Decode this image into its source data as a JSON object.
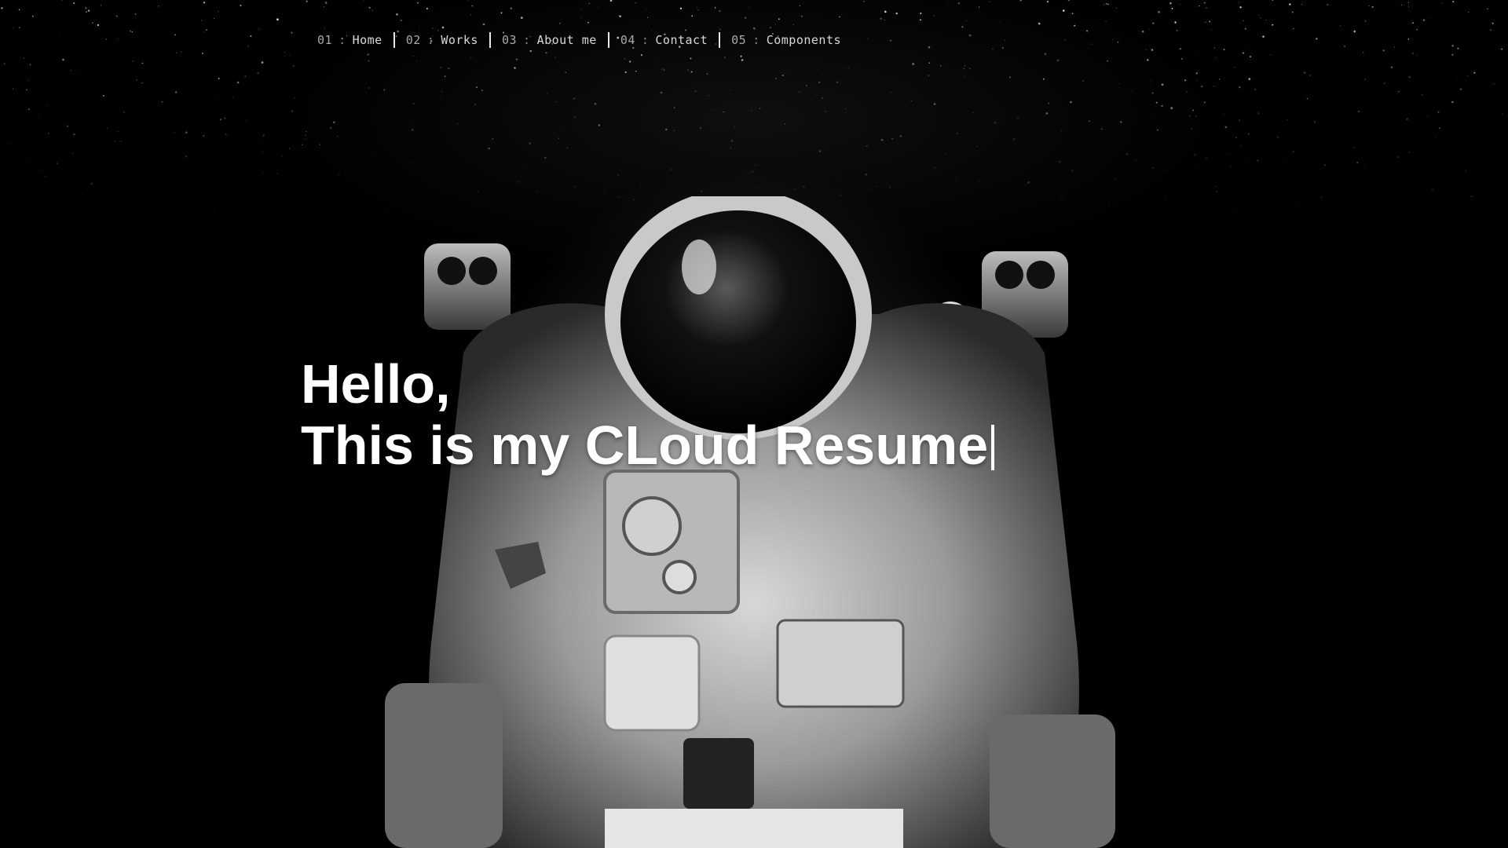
{
  "nav": {
    "items": [
      {
        "num": "01",
        "sep": ":",
        "label": "Home"
      },
      {
        "num": "02",
        "sep": ":",
        "label": "Works"
      },
      {
        "num": "03",
        "sep": ":",
        "label": "About me"
      },
      {
        "num": "04",
        "sep": ":",
        "label": "Contact"
      },
      {
        "num": "05",
        "sep": ":",
        "label": "Components"
      }
    ]
  },
  "hero": {
    "greeting": "Hello,",
    "headline": "This is my CLoud Resume"
  },
  "colors": {
    "background": "#000000",
    "text": "#ffffff",
    "nav_text": "#d9d9d9"
  },
  "icons": {
    "typing_cursor": "text-cursor-icon"
  }
}
